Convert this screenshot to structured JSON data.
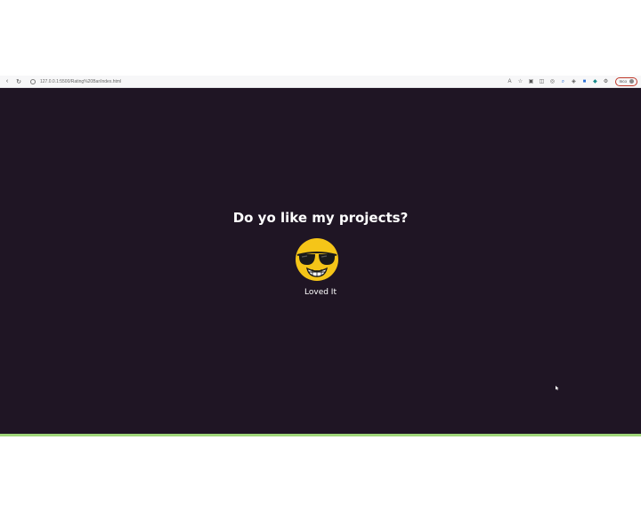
{
  "browser": {
    "url": "127.0.0.1:5500/Rating%20Bar/index.html",
    "profile_label": "Inco"
  },
  "rating": {
    "question": "Do yo like my projects?",
    "current_label": "Loved It",
    "current_emoji": "cool-sunglasses-grin"
  },
  "colors": {
    "page_background": "#1f1524",
    "text": "#ffffff",
    "emoji_face": "#f5c518",
    "accent_line": "#9fd67a"
  },
  "icons": [
    "back-icon",
    "reload-icon",
    "site-info-icon",
    "read-aloud-icon",
    "favorites-icon",
    "extensions-icon",
    "split-screen-icon",
    "collections-icon",
    "zoom-icon",
    "shopping-icon",
    "browser-essentials-icon",
    "copilot-icon"
  ]
}
